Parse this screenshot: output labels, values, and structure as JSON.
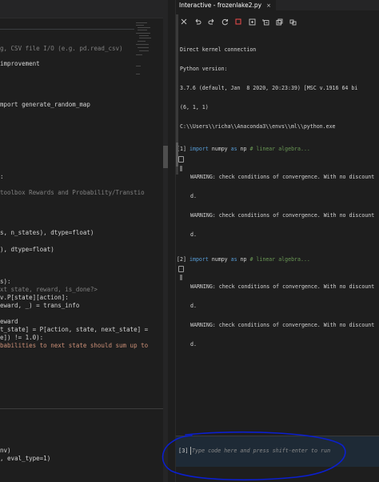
{
  "interactive": {
    "tab_title": "Interactive - frozenlake2.py",
    "tab_close": "×",
    "toolbar": [
      "close-icon",
      "undo-icon",
      "redo-icon",
      "restart-icon",
      "stop-icon",
      "expand-icon",
      "collapse-icon",
      "export-icon",
      "variables-icon"
    ],
    "header_lines": [
      "Direct kernel connection",
      "Python version:",
      "3.7.6 (default, Jan  8 2020, 20:23:39) [MSC v.1916 64 bi",
      "(6, 1, 1)",
      "C:\\\\Users\\\\richa\\\\Anaconda3\\\\envs\\\\ml\\\\python.exe"
    ],
    "cells": [
      {
        "num": "[1]",
        "kw": "import",
        "mid": " numpy ",
        "kw2": "as",
        "rest": " np ",
        "comment": "# linear algebra...",
        "outputs": [
          "WARNING: check conditions of convergence. With no discount",
          "d.",
          "WARNING: check conditions of convergence. With no discount",
          "d."
        ]
      },
      {
        "num": "[2]",
        "kw": "import",
        "mid": " numpy ",
        "kw2": "as",
        "rest": " np ",
        "comment": "# linear algebra...",
        "outputs": [
          "WARNING: check conditions of convergence. With no discount",
          "d.",
          "WARNING: check conditions of convergence. With no discount",
          "d."
        ]
      }
    ],
    "input": {
      "num": "[3]",
      "placeholder": "Type code here and press shift-enter to run"
    }
  },
  "editor": {
    "lines": [
      {
        "text": "g, CSV file I/O (e.g. pd.read_csv)",
        "cls": "c-gray"
      },
      {
        "text": "improvement",
        "cls": "c-txt"
      },
      {
        "text": "mport generate_random_map",
        "cls": "c-txt"
      },
      {
        "text": ":",
        "cls": "c-txt"
      },
      {
        "text": "toolbox Rewards and Probability/Transtio",
        "cls": "c-gray"
      },
      {
        "text": "s, n_states), dtype=float)",
        "cls": "c-txt"
      },
      {
        "text": "), dtype=float)",
        "cls": "c-txt"
      },
      {
        "text": "s):",
        "cls": "c-txt"
      },
      {
        "text": "xt state, reward, is_done?>",
        "cls": "c-gray"
      },
      {
        "text": "v.P[state][action]:",
        "cls": "c-txt"
      },
      {
        "text": "eward, _) = trans_info",
        "cls": "c-txt"
      },
      {
        "text": "eward",
        "cls": "c-txt"
      },
      {
        "text": "t_state] = P[action, state, next_state] =",
        "cls": "c-txt"
      },
      {
        "text": "e]) != 1.0):",
        "cls": "c-txt"
      },
      {
        "text": "babilities to next state should sum up to",
        "cls": "c-str"
      },
      {
        "text": "nv)",
        "cls": "c-txt"
      },
      {
        "text": ", eval_type=1)",
        "cls": "c-txt"
      }
    ]
  },
  "colors": {
    "background": "#1e1e1e",
    "accent": "#0b1fcf",
    "stop_icon": "#f14c4c"
  }
}
